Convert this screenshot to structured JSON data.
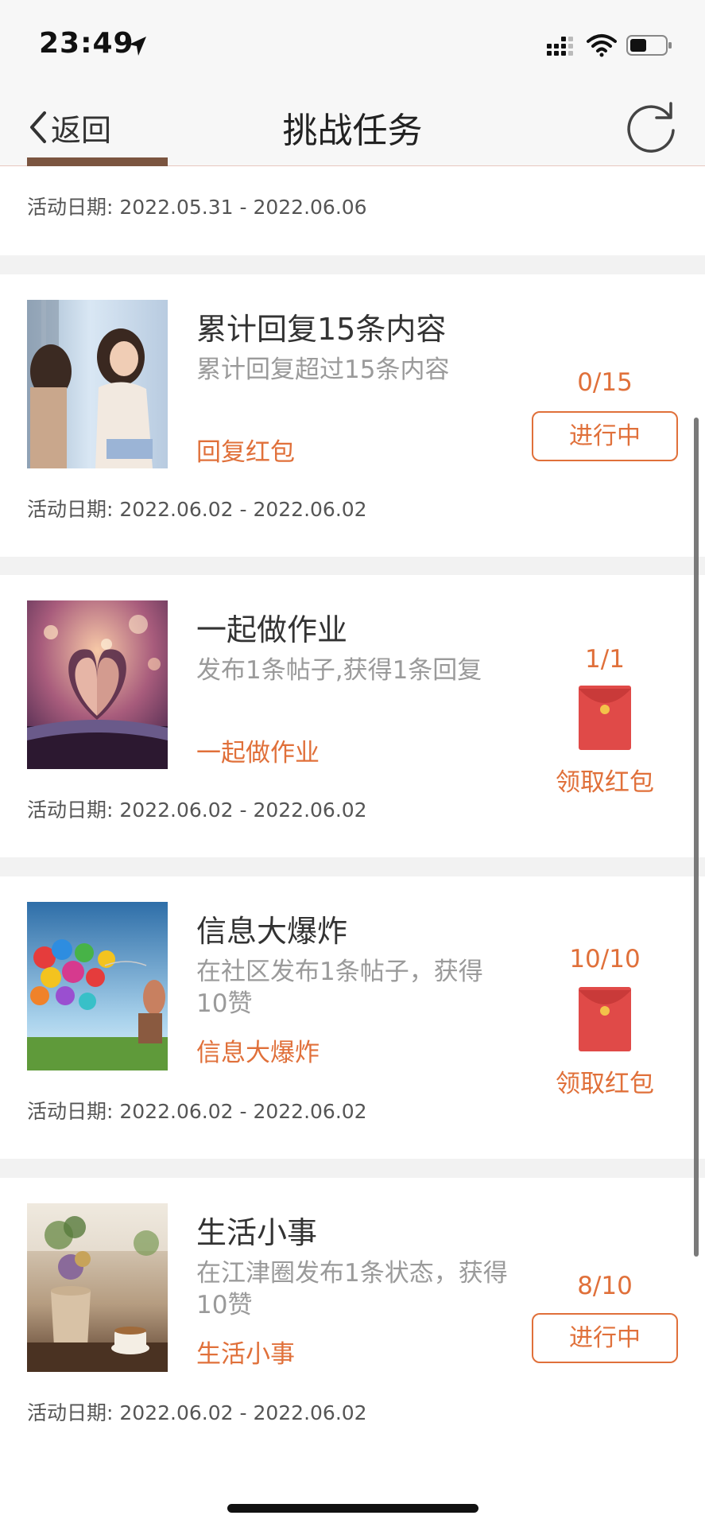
{
  "status_bar": {
    "time": "23:49"
  },
  "nav": {
    "back_label": "返回",
    "title": "挑战任务"
  },
  "tasks": [
    {
      "date_label": "活动日期:",
      "date": "2022.05.31 - 2022.06.06"
    },
    {
      "title": "累计回复15条内容",
      "description": "累计回复超过15条内容",
      "tag": "回复红包",
      "progress": "0/15",
      "status": "进行中",
      "date_label": "活动日期:",
      "date": "2022.06.02 - 2022.06.02"
    },
    {
      "title": "一起做作业",
      "description": "发布1条帖子,获得1条回复",
      "tag": "一起做作业",
      "progress": "1/1",
      "claim_label": "领取红包",
      "date_label": "活动日期:",
      "date": "2022.06.02 - 2022.06.02"
    },
    {
      "title": "信息大爆炸",
      "description": "在社区发布1条帖子，获得10赞",
      "tag": "信息大爆炸",
      "progress": "10/10",
      "claim_label": "领取红包",
      "date_label": "活动日期:",
      "date": "2022.06.02 - 2022.06.02"
    },
    {
      "title": "生活小事",
      "description": "在江津圈发布1条状态，获得10赞",
      "tag": "生活小事",
      "progress": "8/10",
      "status": "进行中",
      "date_label": "活动日期:",
      "date": "2022.06.02 - 2022.06.02"
    }
  ],
  "colors": {
    "accent": "#e0703a",
    "envelope": "#e04a48"
  },
  "icons": [
    "location-arrow-icon",
    "signal-icon",
    "wifi-icon",
    "battery-icon",
    "chevron-left-icon",
    "refresh-icon",
    "red-envelope-icon"
  ]
}
